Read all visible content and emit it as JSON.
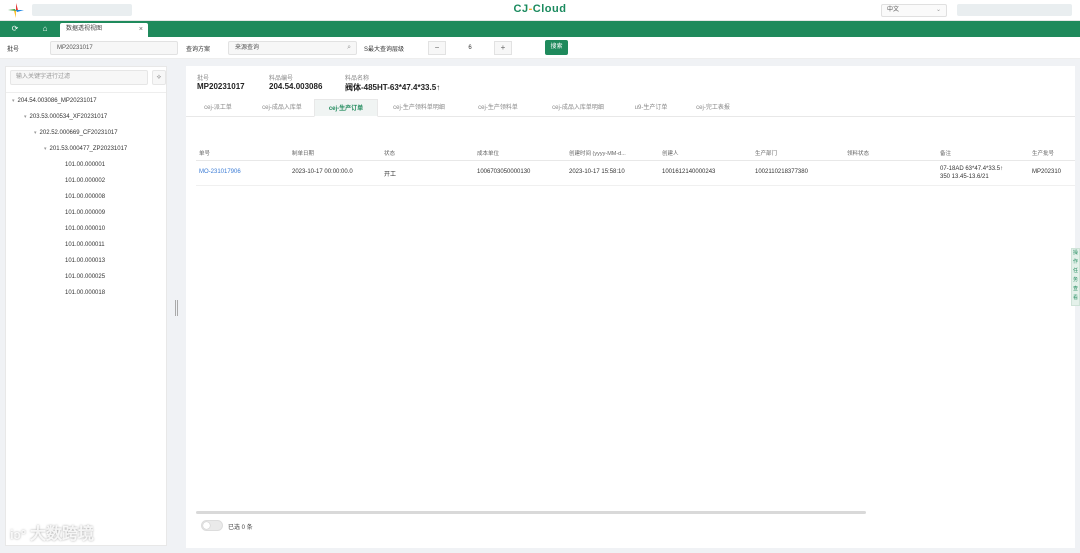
{
  "app": {
    "brand_main": "CJ",
    "brand_dash": "-",
    "brand_tail": "Cloud",
    "language": "中文"
  },
  "tabs": {
    "active_tab": "数据透视视图"
  },
  "query": {
    "batch_label": "批号",
    "batch_value": "MP20231017",
    "scheme_label": "查询方案",
    "scheme_value": "来源查询",
    "max_level_label": "S最大查询层级",
    "max_level_value": "6",
    "search_label": "搜索"
  },
  "tree": {
    "filter_placeholder": "输入关键字进行过滤",
    "nodes": [
      "204.54.003086_MP20231017",
      "203.53.000534_XF20231017",
      "202.52.000669_CF20231017",
      "201.53.000477_ZP20231017",
      "101.00.000001",
      "101.00.000002",
      "101.00.000008",
      "101.00.000009",
      "101.00.000010",
      "101.00.000011",
      "101.00.000013",
      "101.00.000025",
      "101.00.000018"
    ]
  },
  "meta": {
    "batch_label": "批号",
    "batch_value": "MP20231017",
    "code_label": "料品编号",
    "code_value": "204.54.003086",
    "name_label": "料品名称",
    "name_value": "阀体-485HT-63*47.4*33.5↑"
  },
  "subtabs": [
    "cej-派工单",
    "cej-成品入库单",
    "cej-生产订单",
    "cej-生产领料单明细",
    "cej-生产领料单",
    "cej-成品入库单明细",
    "u9-生产订单",
    "cej-完工表报"
  ],
  "table": {
    "headers": [
      "单号",
      "制单日期",
      "状态",
      "成本单位",
      "创建时间 (yyyy-MM-d...",
      "创建人",
      "生产部门",
      "领料状态",
      "备注",
      "生产批号"
    ],
    "row": {
      "no": "MO-231017906",
      "date": "2023-10-17 00:00:00.0",
      "status": "开工",
      "cost_unit": "1006703050000130",
      "created": "2023-10-17 15:58:10",
      "creator": "1001612140000243",
      "dept": "1002110218377380",
      "pick_status": "",
      "remark_1": "07-18AD 63*47.4*33.5↑",
      "remark_2": "350 13.45-13.6/21",
      "batch": "MP202310"
    }
  },
  "footer": {
    "selected": "已选 0 条"
  },
  "side_float": "操作任务查看",
  "watermark": "大数跨境",
  "colors": {
    "primary": "#1f8a5c",
    "link": "#3a7bd5",
    "brand_dash": "#f5a623"
  },
  "icons": [
    "app-logo-icon",
    "refresh-icon",
    "home-icon",
    "close-icon",
    "search-icon",
    "filter-icon",
    "chevron-down-icon"
  ]
}
